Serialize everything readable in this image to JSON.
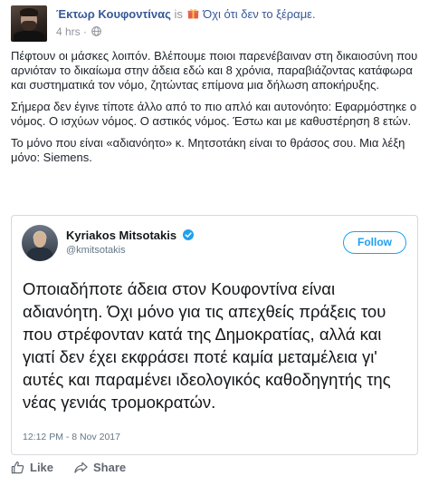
{
  "post": {
    "author": "Έκτωρ Κουφοντίνας",
    "is_label": "is",
    "feeling": "Όχι ότι δεν το ξέραμε.",
    "time": "4 hrs",
    "separator": "·",
    "paragraphs": [
      "Πέφτουν οι μάσκες λοιπόν. Βλέπουμε ποιοι παρενέβαιναν στη δικαιοσύνη που αρνιόταν το δικαίωμα στην άδεια εδώ και 8 χρόνια, παραβιάζοντας κατάφωρα και συστηματικά τον νόμο, ζητώντας επίμονα μια δήλωση αποκήρυξης.",
      "Σήμερα δεν έγινε τίποτε άλλο από το πιο απλό και αυτονόητο: Εφαρμόστηκε ο νόμος. Ο ισχύων νόμος. Ο αστικός νόμος. Έστω και με καθυστέρηση 8 ετών.",
      "Το μόνο που είναι «αδιανόητο» κ. Μητσοτάκη είναι το θράσος σου. Μια λέξη μόνο: Siemens."
    ]
  },
  "tweet": {
    "name": "Kyriakos Mitsotakis",
    "handle": "@kmitsotakis",
    "follow_label": "Follow",
    "text": "Οποιαδήποτε άδεια στον Κουφοντίνα είναι αδιανόητη. Όχι μόνο για τις απεχθείς πράξεις του που στρέφονταν κατά της Δημοκρατίας, αλλά και γιατί δεν έχει εκφράσει ποτέ καμία μεταμέλεια γι' αυτές και παραμένει ιδεολογικός καθοδηγητής της νέας γενιάς τρομοκρατών.",
    "timestamp": "12:12 PM - 8 Nov 2017"
  },
  "actions": {
    "like_label": "Like",
    "share_label": "Share"
  },
  "icons": {
    "feeling": "gift-emoji-icon",
    "privacy": "globe-icon",
    "verified": "verified-badge-icon",
    "like": "thumbs-up-icon",
    "share": "share-arrow-icon"
  },
  "colors": {
    "link": "#365899",
    "meta": "#90949c",
    "twitter_blue": "#1da1f2"
  }
}
